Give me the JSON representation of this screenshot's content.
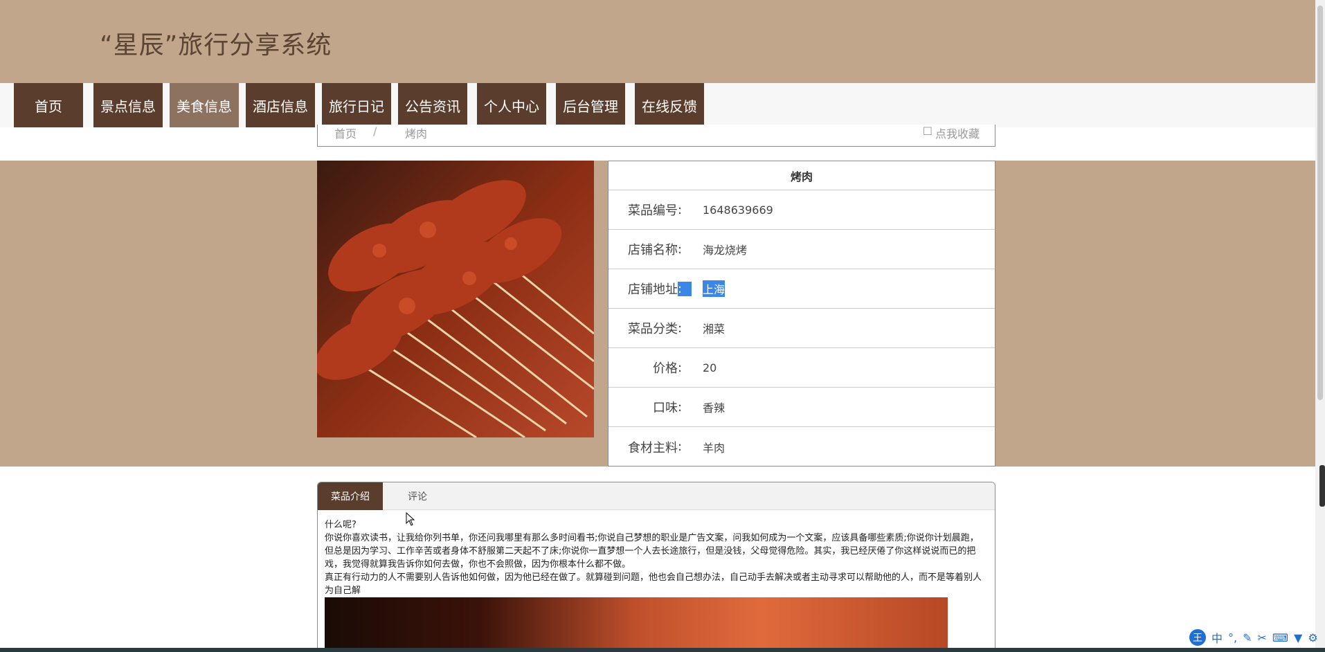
{
  "site": {
    "title": "“星辰”旅行分享系统"
  },
  "nav": [
    {
      "label": "首页",
      "active": false
    },
    {
      "label": "景点信息",
      "active": false
    },
    {
      "label": "美食信息",
      "active": true
    },
    {
      "label": "酒店信息",
      "active": false
    },
    {
      "label": "旅行日记",
      "active": false
    },
    {
      "label": "公告资讯",
      "active": false
    },
    {
      "label": "个人中心",
      "active": false
    },
    {
      "label": "后台管理",
      "active": false
    },
    {
      "label": "在线反馈",
      "active": false
    }
  ],
  "breadcrumb": {
    "home": "首页",
    "separator": "/",
    "current": "烤肉",
    "collect": "点我收藏"
  },
  "detail": {
    "title": "烤肉",
    "rows": [
      {
        "label": "菜品编号",
        "value": "1648639669"
      },
      {
        "label": "店铺名称",
        "value": "海龙烧烤"
      },
      {
        "label": "店铺地址",
        "value": "上海"
      },
      {
        "label": "菜品分类",
        "value": "湘菜"
      },
      {
        "label": "价格",
        "value": "20"
      },
      {
        "label": "口味",
        "value": "香辣"
      },
      {
        "label": "食材主料",
        "value": "羊肉"
      }
    ],
    "colon": ":"
  },
  "tabs": [
    {
      "label": "菜品介绍",
      "active": true
    },
    {
      "label": "评论",
      "active": false
    }
  ],
  "content": {
    "line1": "什么呢?",
    "line2": "你说你喜欢读书，让我给你列书单，你还问我哪里有那么多时间看书;你说自己梦想的职业是广告文案，问我如何成为一个文案，应该具备哪些素质;你说你计划晨跑，但总是因为学习、工作辛苦或者身体不舒服第二天起不了床;你说你一直梦想一个人去长途旅行，但是没钱，父母觉得危险。其实，我已经厌倦了你这样说说而已的把戏，我觉得就算我告诉你如何去做，你也不会照做，因为你根本什么都不做。",
    "line3": "真正有行动力的人不需要别人告诉他如何做，因为他已经在做了。就算碰到问题，他也会自己想办法，自己动手去解决或者主动寻求可以帮助他的人，而不是等着别人为自己解"
  },
  "ime": {
    "logo": "王",
    "mode": "中",
    "symbols": "°,",
    "icons": [
      "pen-icon",
      "scissors-icon",
      "keyboard-icon",
      "shirt-icon",
      "gear-icon"
    ]
  },
  "colors": {
    "header": "#c2a68c",
    "nav": "#5b3d2e",
    "navActive": "#8d735f",
    "selection": "#3b87e8"
  }
}
